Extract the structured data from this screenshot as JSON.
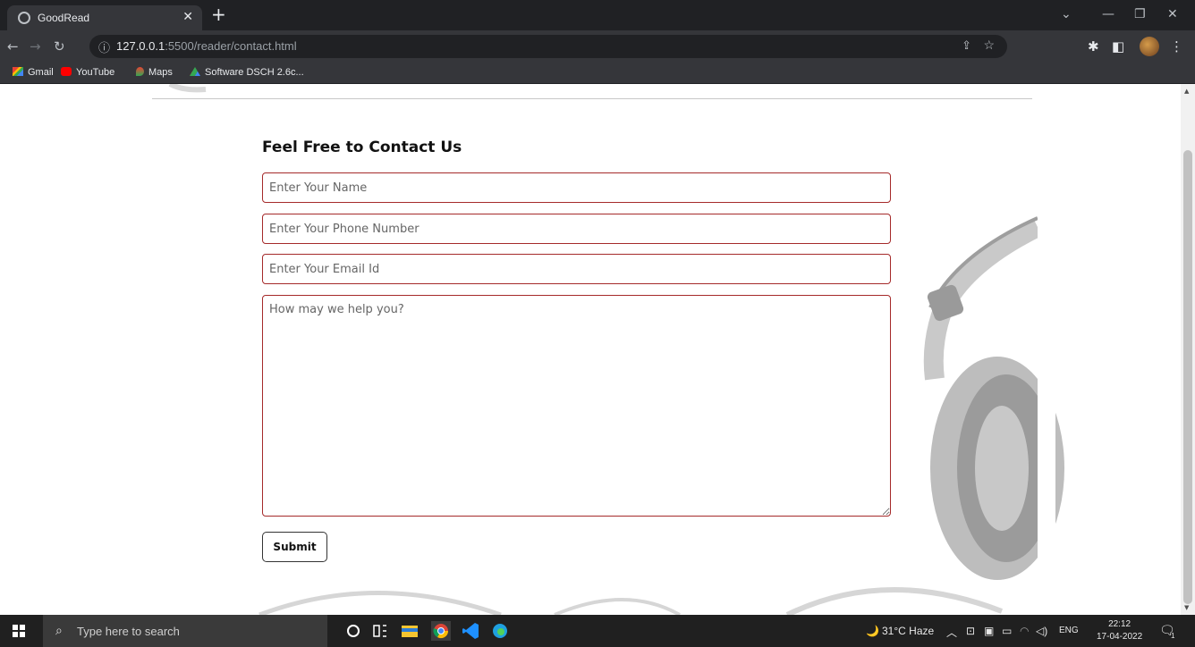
{
  "browser": {
    "tab_title": "GoodRead",
    "url_host": "127.0.0.1",
    "url_rest": ":5500/reader/contact.html",
    "bookmarks": [
      {
        "label": "Gmail"
      },
      {
        "label": "YouTube"
      },
      {
        "label": "Maps"
      },
      {
        "label": "Software DSCH 2.6c..."
      }
    ]
  },
  "contact": {
    "title": "Feel Free to Contact Us",
    "name_placeholder": "Enter Your Name",
    "phone_placeholder": "Enter Your Phone Number",
    "email_placeholder": "Enter Your Email Id",
    "message_placeholder": "How may we help you?",
    "submit_label": "Submit"
  },
  "taskbar": {
    "search_placeholder": "Type here to search",
    "weather": "31°C Haze",
    "language": "ENG",
    "time": "22:12",
    "date": "17-04-2022",
    "notification_count": "1"
  },
  "colors": {
    "field_border": "#a52a2a",
    "chrome_dark": "#202124",
    "chrome_mid": "#35363a"
  }
}
